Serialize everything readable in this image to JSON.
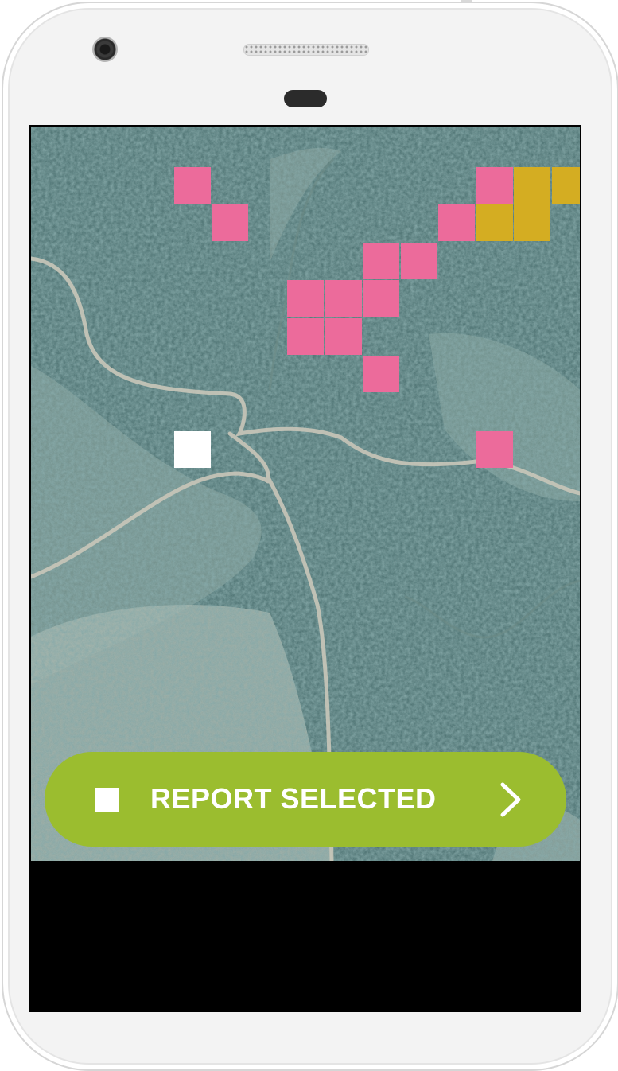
{
  "app": {
    "report_button": {
      "label": "REPORT SELECTED",
      "checkbox_checked": false,
      "chevron_icon": "chevron-right-icon"
    },
    "map": {
      "type": "satellite",
      "grid": {
        "tiles": [
          {
            "col": 3,
            "row": 1,
            "state": "selected"
          },
          {
            "col": 4,
            "row": 2,
            "state": "selected"
          },
          {
            "col": 11,
            "row": 1,
            "state": "selected"
          },
          {
            "col": 12,
            "row": 1,
            "state": "flagged"
          },
          {
            "col": 13,
            "row": 1,
            "state": "flagged"
          },
          {
            "col": 10,
            "row": 2,
            "state": "selected"
          },
          {
            "col": 11,
            "row": 2,
            "state": "flagged"
          },
          {
            "col": 12,
            "row": 2,
            "state": "flagged"
          },
          {
            "col": 8,
            "row": 3,
            "state": "selected"
          },
          {
            "col": 9,
            "row": 3,
            "state": "selected"
          },
          {
            "col": 6,
            "row": 4,
            "state": "selected"
          },
          {
            "col": 7,
            "row": 4,
            "state": "selected"
          },
          {
            "col": 8,
            "row": 4,
            "state": "selected"
          },
          {
            "col": 6,
            "row": 5,
            "state": "selected"
          },
          {
            "col": 7,
            "row": 5,
            "state": "selected"
          },
          {
            "col": 8,
            "row": 6,
            "state": "selected"
          },
          {
            "col": 3,
            "row": 8,
            "state": "current"
          },
          {
            "col": 11,
            "row": 8,
            "state": "selected"
          }
        ]
      }
    },
    "colors": {
      "selected": "#ec6b9b",
      "flagged": "#d4ad22",
      "current": "#ffffff",
      "button": "#9bbd2f"
    }
  }
}
